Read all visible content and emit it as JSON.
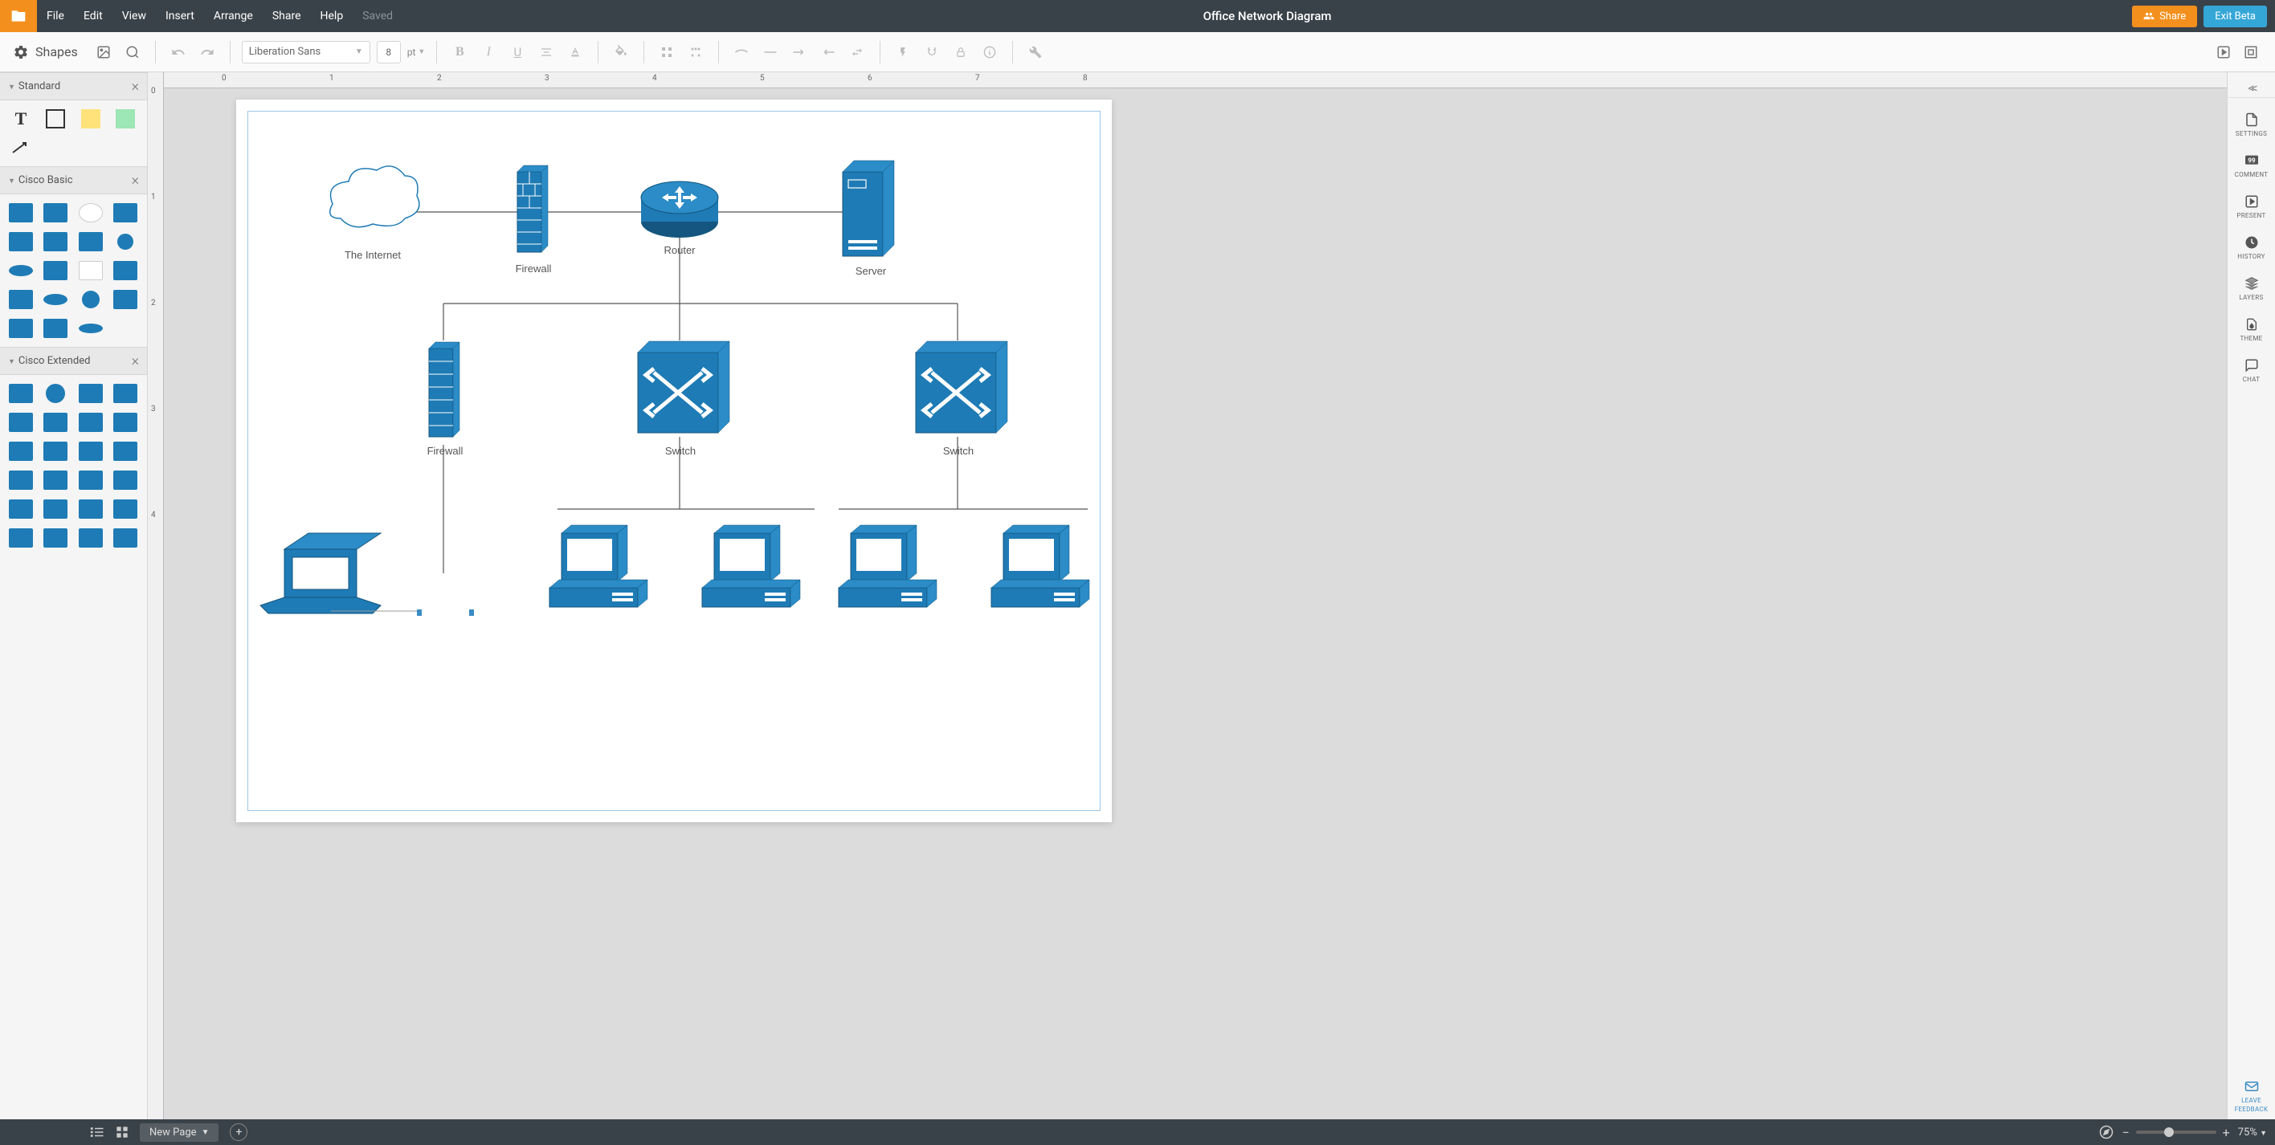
{
  "menubar": {
    "file": "File",
    "edit": "Edit",
    "view": "View",
    "insert": "Insert",
    "arrange": "Arrange",
    "share": "Share",
    "help": "Help",
    "saved": "Saved",
    "title": "Office Network Diagram",
    "share_btn": "Share",
    "exit_btn": "Exit Beta"
  },
  "toolbar": {
    "shapes_label": "Shapes",
    "font": "Liberation Sans",
    "font_size": "8",
    "font_unit": "pt"
  },
  "shapes_panel": {
    "sections": {
      "standard": "Standard",
      "cisco_basic": "Cisco Basic",
      "cisco_extended": "Cisco Extended"
    }
  },
  "ruler": {
    "h_ticks": [
      "0",
      "1",
      "2",
      "3",
      "4",
      "5",
      "6",
      "7",
      "8"
    ],
    "v_ticks": [
      "0",
      "1",
      "2",
      "3",
      "4"
    ]
  },
  "diagram": {
    "nodes": {
      "internet": "The Internet",
      "firewall1": "Firewall",
      "router": "Router",
      "server": "Server",
      "firewall2": "Firewall",
      "switch1": "Switch",
      "switch2": "Switch"
    },
    "colors": {
      "cisco_blue": "#1e7bb5",
      "cisco_dark": "#14567f"
    }
  },
  "right_panel": {
    "settings": "SETTINGS",
    "comment": "COMMENT",
    "present": "PRESENT",
    "history": "HISTORY",
    "layers": "LAYERS",
    "theme": "THEME",
    "chat": "CHAT",
    "feedback_line1": "LEAVE",
    "feedback_line2": "FEEDBACK"
  },
  "bottombar": {
    "page_tab": "New Page",
    "zoom": "75%"
  }
}
